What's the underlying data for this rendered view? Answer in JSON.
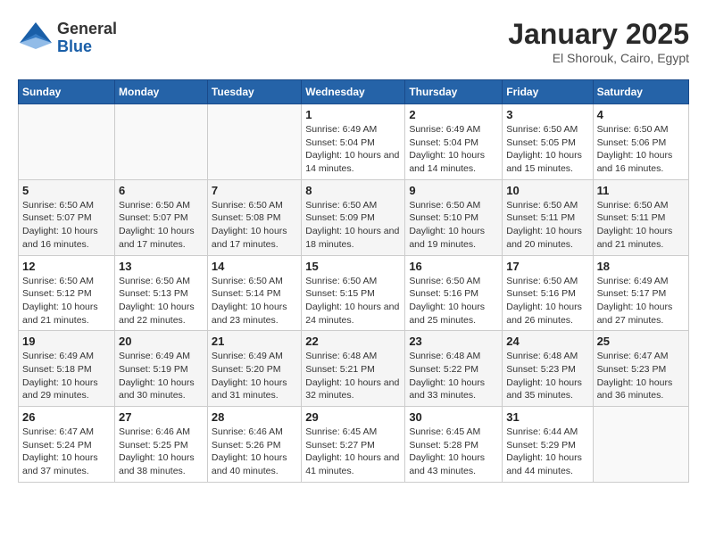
{
  "header": {
    "logo": {
      "general": "General",
      "blue": "Blue",
      "tagline": ""
    },
    "title": "January 2025",
    "subtitle": "El Shorouk, Cairo, Egypt"
  },
  "calendar": {
    "days_of_week": [
      "Sunday",
      "Monday",
      "Tuesday",
      "Wednesday",
      "Thursday",
      "Friday",
      "Saturday"
    ],
    "weeks": [
      [
        {
          "day": "",
          "info": ""
        },
        {
          "day": "",
          "info": ""
        },
        {
          "day": "",
          "info": ""
        },
        {
          "day": "1",
          "info": "Sunrise: 6:49 AM\nSunset: 5:04 PM\nDaylight: 10 hours and 14 minutes."
        },
        {
          "day": "2",
          "info": "Sunrise: 6:49 AM\nSunset: 5:04 PM\nDaylight: 10 hours and 14 minutes."
        },
        {
          "day": "3",
          "info": "Sunrise: 6:50 AM\nSunset: 5:05 PM\nDaylight: 10 hours and 15 minutes."
        },
        {
          "day": "4",
          "info": "Sunrise: 6:50 AM\nSunset: 5:06 PM\nDaylight: 10 hours and 16 minutes."
        }
      ],
      [
        {
          "day": "5",
          "info": "Sunrise: 6:50 AM\nSunset: 5:07 PM\nDaylight: 10 hours and 16 minutes."
        },
        {
          "day": "6",
          "info": "Sunrise: 6:50 AM\nSunset: 5:07 PM\nDaylight: 10 hours and 17 minutes."
        },
        {
          "day": "7",
          "info": "Sunrise: 6:50 AM\nSunset: 5:08 PM\nDaylight: 10 hours and 17 minutes."
        },
        {
          "day": "8",
          "info": "Sunrise: 6:50 AM\nSunset: 5:09 PM\nDaylight: 10 hours and 18 minutes."
        },
        {
          "day": "9",
          "info": "Sunrise: 6:50 AM\nSunset: 5:10 PM\nDaylight: 10 hours and 19 minutes."
        },
        {
          "day": "10",
          "info": "Sunrise: 6:50 AM\nSunset: 5:11 PM\nDaylight: 10 hours and 20 minutes."
        },
        {
          "day": "11",
          "info": "Sunrise: 6:50 AM\nSunset: 5:11 PM\nDaylight: 10 hours and 21 minutes."
        }
      ],
      [
        {
          "day": "12",
          "info": "Sunrise: 6:50 AM\nSunset: 5:12 PM\nDaylight: 10 hours and 21 minutes."
        },
        {
          "day": "13",
          "info": "Sunrise: 6:50 AM\nSunset: 5:13 PM\nDaylight: 10 hours and 22 minutes."
        },
        {
          "day": "14",
          "info": "Sunrise: 6:50 AM\nSunset: 5:14 PM\nDaylight: 10 hours and 23 minutes."
        },
        {
          "day": "15",
          "info": "Sunrise: 6:50 AM\nSunset: 5:15 PM\nDaylight: 10 hours and 24 minutes."
        },
        {
          "day": "16",
          "info": "Sunrise: 6:50 AM\nSunset: 5:16 PM\nDaylight: 10 hours and 25 minutes."
        },
        {
          "day": "17",
          "info": "Sunrise: 6:50 AM\nSunset: 5:16 PM\nDaylight: 10 hours and 26 minutes."
        },
        {
          "day": "18",
          "info": "Sunrise: 6:49 AM\nSunset: 5:17 PM\nDaylight: 10 hours and 27 minutes."
        }
      ],
      [
        {
          "day": "19",
          "info": "Sunrise: 6:49 AM\nSunset: 5:18 PM\nDaylight: 10 hours and 29 minutes."
        },
        {
          "day": "20",
          "info": "Sunrise: 6:49 AM\nSunset: 5:19 PM\nDaylight: 10 hours and 30 minutes."
        },
        {
          "day": "21",
          "info": "Sunrise: 6:49 AM\nSunset: 5:20 PM\nDaylight: 10 hours and 31 minutes."
        },
        {
          "day": "22",
          "info": "Sunrise: 6:48 AM\nSunset: 5:21 PM\nDaylight: 10 hours and 32 minutes."
        },
        {
          "day": "23",
          "info": "Sunrise: 6:48 AM\nSunset: 5:22 PM\nDaylight: 10 hours and 33 minutes."
        },
        {
          "day": "24",
          "info": "Sunrise: 6:48 AM\nSunset: 5:23 PM\nDaylight: 10 hours and 35 minutes."
        },
        {
          "day": "25",
          "info": "Sunrise: 6:47 AM\nSunset: 5:23 PM\nDaylight: 10 hours and 36 minutes."
        }
      ],
      [
        {
          "day": "26",
          "info": "Sunrise: 6:47 AM\nSunset: 5:24 PM\nDaylight: 10 hours and 37 minutes."
        },
        {
          "day": "27",
          "info": "Sunrise: 6:46 AM\nSunset: 5:25 PM\nDaylight: 10 hours and 38 minutes."
        },
        {
          "day": "28",
          "info": "Sunrise: 6:46 AM\nSunset: 5:26 PM\nDaylight: 10 hours and 40 minutes."
        },
        {
          "day": "29",
          "info": "Sunrise: 6:45 AM\nSunset: 5:27 PM\nDaylight: 10 hours and 41 minutes."
        },
        {
          "day": "30",
          "info": "Sunrise: 6:45 AM\nSunset: 5:28 PM\nDaylight: 10 hours and 43 minutes."
        },
        {
          "day": "31",
          "info": "Sunrise: 6:44 AM\nSunset: 5:29 PM\nDaylight: 10 hours and 44 minutes."
        },
        {
          "day": "",
          "info": ""
        }
      ]
    ]
  }
}
